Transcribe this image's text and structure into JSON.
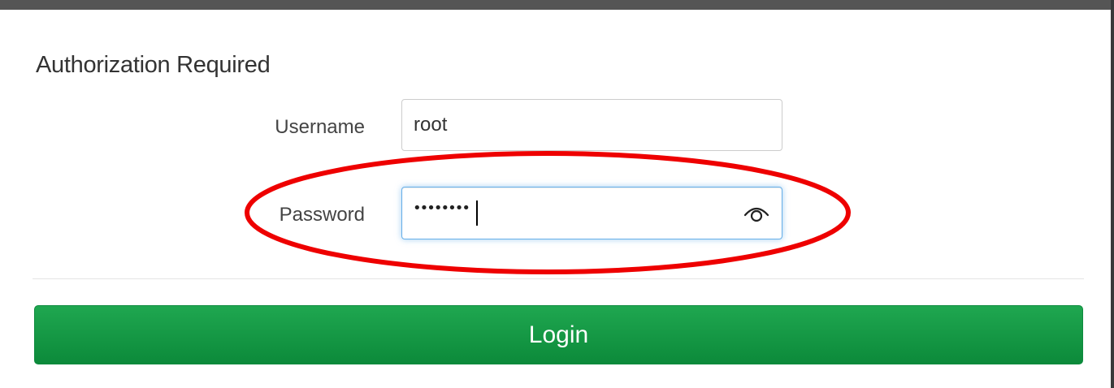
{
  "form": {
    "title": "Authorization Required",
    "username_label": "Username",
    "username_value": "root",
    "password_label": "Password",
    "password_masked": "••••••••",
    "password_toggle_icon": "eye-icon",
    "login_label": "Login"
  },
  "colors": {
    "login_button": "#12994a",
    "focus_border": "#66afe9",
    "annotation": "#ee0000",
    "top_bar": "#555555"
  }
}
